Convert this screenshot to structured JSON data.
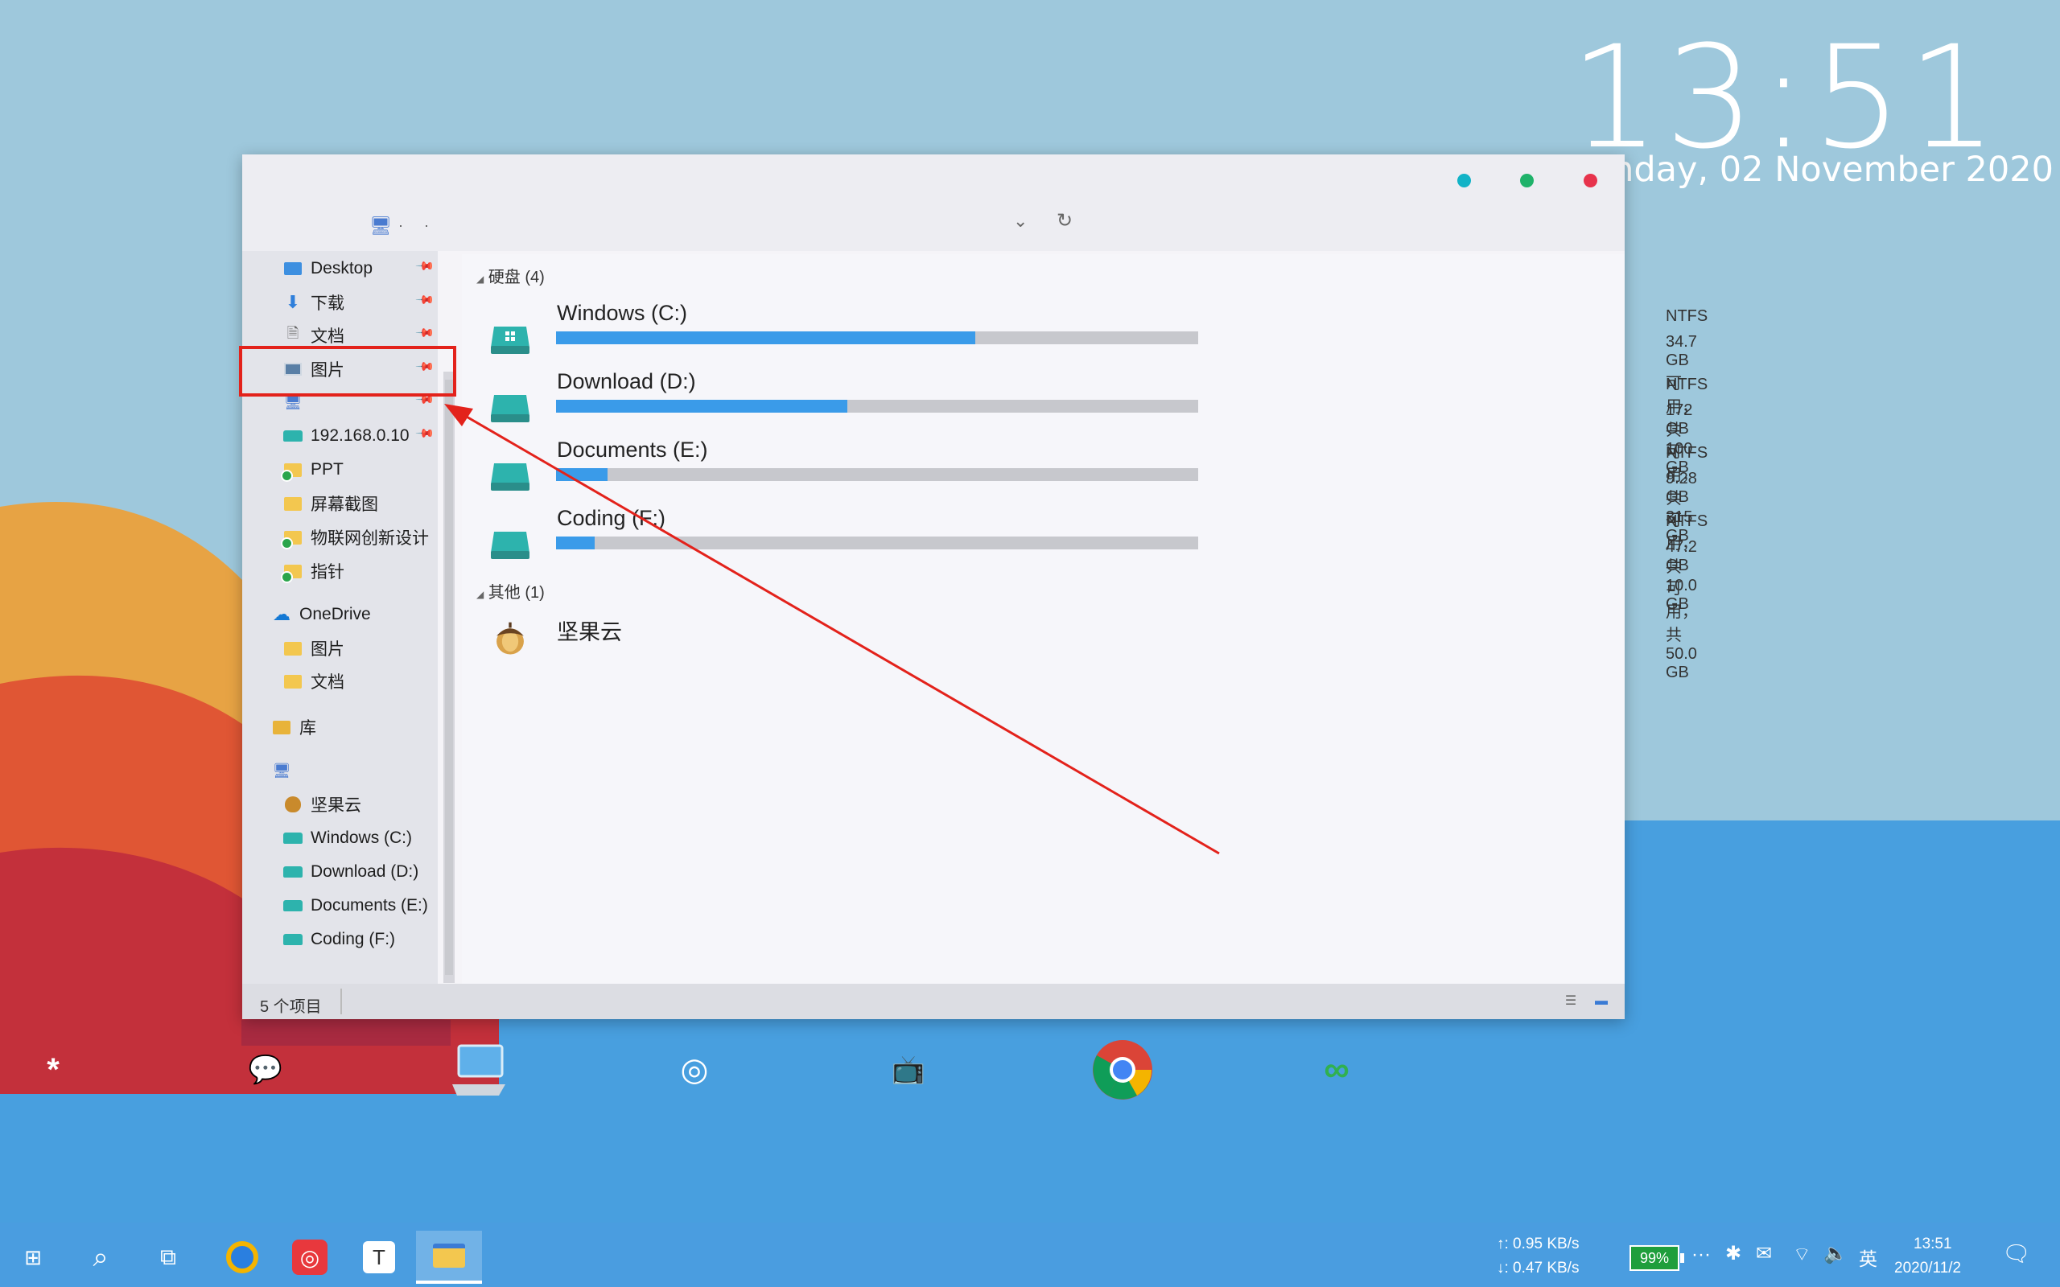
{
  "clock": {
    "time": "13:51",
    "date": "Monday, 02 November 2020"
  },
  "window": {
    "address_dots": [
      "·",
      "·"
    ],
    "dropdown_icon": "chevron-down-icon",
    "refresh_icon": "refresh-icon",
    "nav": {
      "quick_access": [
        {
          "label": "Desktop",
          "pinned": true,
          "icon": "desktop-folder-icon"
        },
        {
          "label": "下载",
          "pinned": true,
          "icon": "download-arrow-icon"
        },
        {
          "label": "文档",
          "pinned": true,
          "icon": "document-icon"
        },
        {
          "label": "图片",
          "pinned": true,
          "icon": "picture-icon"
        },
        {
          "label": "",
          "pinned": true,
          "icon": "this-pc-icon"
        },
        {
          "label": "192.168.0.10",
          "pinned": true,
          "icon": "network-drive-icon"
        },
        {
          "label": "PPT",
          "pinned": false,
          "icon": "folder-sync-icon"
        },
        {
          "label": "屏幕截图",
          "pinned": false,
          "icon": "folder-icon"
        },
        {
          "label": "物联网创新设计",
          "pinned": false,
          "icon": "folder-sync-icon"
        },
        {
          "label": "指针",
          "pinned": false,
          "icon": "folder-sync-icon"
        }
      ],
      "onedrive": {
        "label": "OneDrive",
        "children": [
          "图片",
          "文档"
        ]
      },
      "library": {
        "label": "库"
      },
      "this_pc": {
        "label": "",
        "children": [
          "坚果云",
          "Windows (C:)",
          "Download (D:)",
          "Documents (E:)",
          "Coding (F:)"
        ]
      }
    },
    "content": {
      "drives_header": "硬盘 (4)",
      "drives": [
        {
          "name": "Windows (C:)",
          "fs": "NTFS",
          "space": "34.7 GB 可用，共 100 GB",
          "used_fraction": 0.653,
          "icon": "windows-drive-icon"
        },
        {
          "name": "Download (D:)",
          "fs": "NTFS",
          "space": "172 GB 可用，共 315 GB",
          "used_fraction": 0.454,
          "icon": "drive-icon"
        },
        {
          "name": "Documents (E:)",
          "fs": "NTFS",
          "space": "9.28 GB 可用，共 10.0 GB",
          "used_fraction": 0.08,
          "icon": "drive-icon"
        },
        {
          "name": "Coding (F:)",
          "fs": "NTFS",
          "space": "47.2 GB 可用，共 50.0 GB",
          "used_fraction": 0.06,
          "icon": "drive-icon"
        }
      ],
      "other_header": "其他 (1)",
      "other": [
        {
          "name": "坚果云",
          "icon": "acorn-icon"
        }
      ]
    },
    "status": {
      "item_count": "5 个项目"
    },
    "colors": {
      "minimize": "#12b3c7",
      "maximize": "#1fb26a",
      "close": "#e7334c",
      "bar_fill": "#3a9be9"
    }
  },
  "annotation": {
    "color": "#e3221b"
  },
  "dock": [
    {
      "name": "dock-app-asterisk",
      "glyph": "*",
      "bg": "#ffffff",
      "fg": "#1a8fe8"
    },
    {
      "name": "dock-app-wechat",
      "glyph": "💬",
      "bg": "#44ae4a",
      "fg": "#ffffff"
    },
    {
      "name": "dock-app-this-pc",
      "glyph": "",
      "bg": "transparent",
      "fg": "#ffffff"
    },
    {
      "name": "dock-app-netease-music",
      "glyph": "◎",
      "bg": "#e8383d",
      "fg": "#ffffff"
    },
    {
      "name": "dock-app-bilibili",
      "glyph": "📺",
      "bg": "#f27a9c",
      "fg": "#ffffff"
    },
    {
      "name": "dock-app-chrome",
      "glyph": "",
      "bg": "#ffffff",
      "fg": "#ffffff"
    },
    {
      "name": "dock-app-cloud",
      "glyph": "∞",
      "bg": "#ffffff",
      "fg": "#30b050"
    }
  ],
  "taskbar": {
    "net_up": "↑: 0.95 KB/s",
    "net_down": "↓: 0.47 KB/s",
    "battery": "99%",
    "ime": "英",
    "tray_time": "13:51",
    "tray_date": "2020/11/2",
    "overflow": "···"
  }
}
